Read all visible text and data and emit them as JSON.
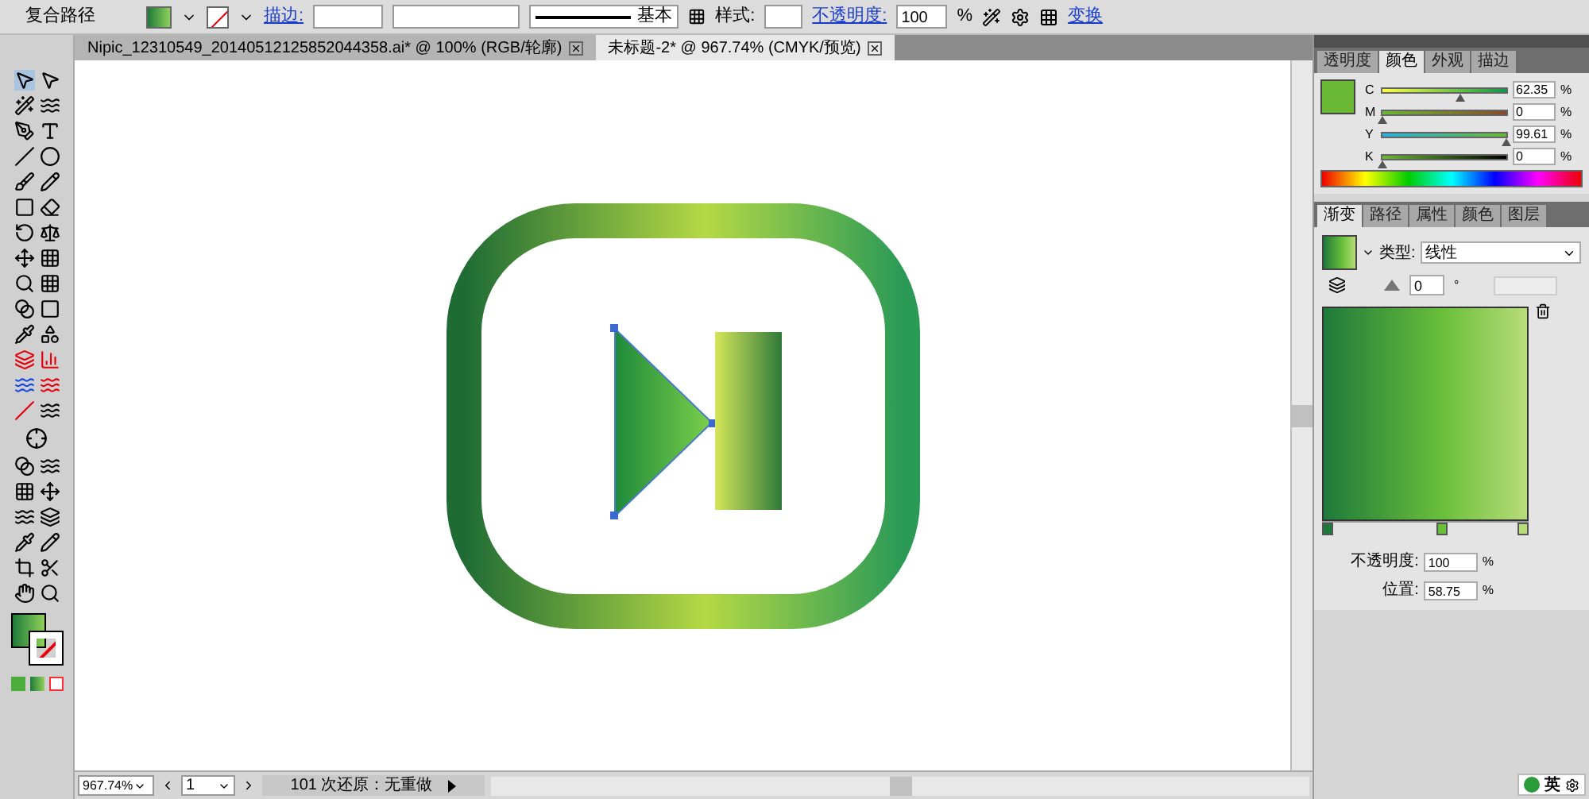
{
  "control_bar": {
    "object_type": "复合路径",
    "stroke_label": "描边:",
    "stroke_profile": "基本",
    "style_label": "样式:",
    "opacity_label": "不透明度:",
    "opacity_value": "100",
    "percent": "%",
    "transform_link": "变换"
  },
  "doc_tabs": [
    {
      "label": "Nipic_12310549_20140512125852044358.ai* @ 100% (RGB/轮廓)",
      "selected": false
    },
    {
      "label": "未标题-2* @ 967.74% (CMYK/预览)",
      "selected": true
    }
  ],
  "color_panel": {
    "tabs": [
      {
        "label": "透明度",
        "selected": false
      },
      {
        "label": "颜色",
        "selected": true
      },
      {
        "label": "外观",
        "selected": false
      },
      {
        "label": "描边",
        "selected": false
      }
    ],
    "sliders": [
      {
        "channel": "C",
        "value": "62.35",
        "level": 0.6235
      },
      {
        "channel": "M",
        "value": "0",
        "level": 0
      },
      {
        "channel": "Y",
        "value": "99.61",
        "level": 0.9961
      },
      {
        "channel": "K",
        "value": "0",
        "level": 0
      }
    ],
    "percent": "%"
  },
  "gradient_panel": {
    "tabs": [
      {
        "label": "渐变",
        "selected": true
      },
      {
        "label": "路径",
        "selected": false
      },
      {
        "label": "属性",
        "selected": false
      },
      {
        "label": "颜色",
        "selected": false
      },
      {
        "label": "图层",
        "selected": false
      }
    ],
    "type_label": "类型:",
    "type_value": "线性",
    "angle": "0",
    "degree": "°",
    "opacity_label": "不透明度:",
    "opacity_value": "100",
    "location_label": "位置:",
    "location_value": "58.75",
    "percent": "%",
    "stops": [
      {
        "color": "#1e7a3a",
        "level": 0,
        "selected": false
      },
      {
        "color": "#6abf3a",
        "level": 0.5875,
        "selected": false
      },
      {
        "color": "#b8dc7a",
        "level": 1,
        "selected": false
      }
    ]
  },
  "status_bar": {
    "zoom": "967.74%",
    "artboard": "1",
    "history": "101 次还原：无重做"
  },
  "ime": {
    "label": "英"
  }
}
